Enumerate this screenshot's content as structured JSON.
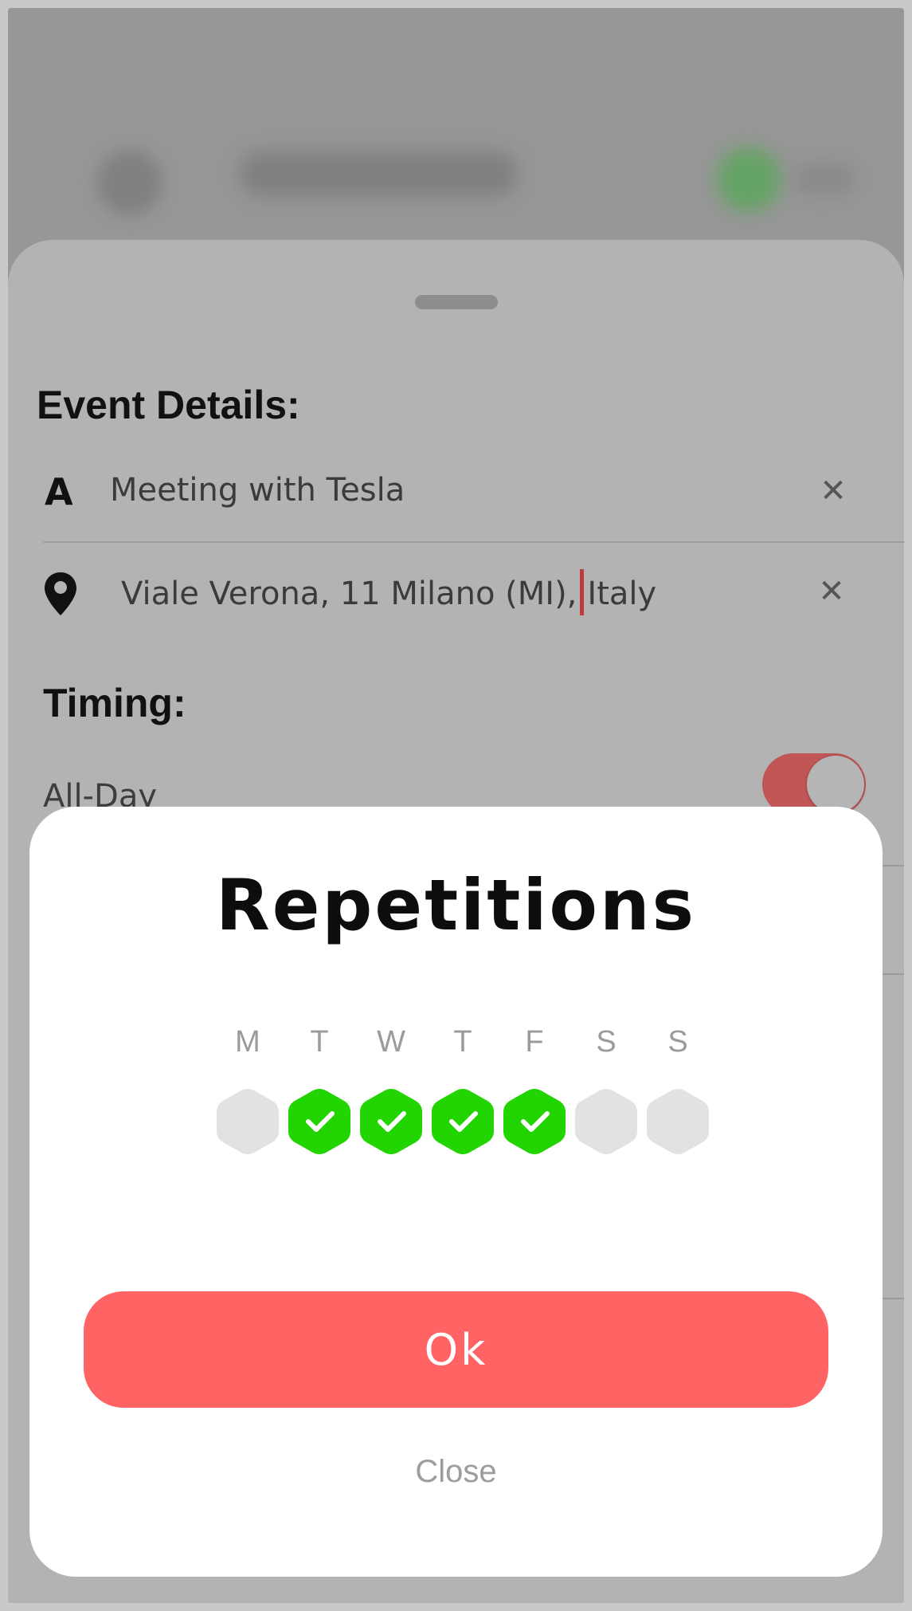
{
  "event_details": {
    "heading": "Event Details:",
    "title_value": "Meeting with Tesla",
    "title_icon": "A",
    "location_before_cursor": "Viale Verona, 11 Milano (MI),",
    "location_after_cursor": "Italy"
  },
  "timing": {
    "heading": "Timing:",
    "all_day_label": "All-Day",
    "all_day_on": true
  },
  "repetitions_modal": {
    "title": "Repetitions",
    "days": [
      {
        "letter": "M",
        "selected": false
      },
      {
        "letter": "T",
        "selected": true
      },
      {
        "letter": "W",
        "selected": true
      },
      {
        "letter": "T",
        "selected": true
      },
      {
        "letter": "F",
        "selected": true
      },
      {
        "letter": "S",
        "selected": false
      },
      {
        "letter": "S",
        "selected": false
      }
    ],
    "ok_label": "Ok",
    "close_label": "Close"
  },
  "colors": {
    "selected_day": "#22d400",
    "unselected_day": "#e2e2e2",
    "primary_button": "#ff6363",
    "toggle_on": "#c15656"
  },
  "icons": {
    "title_field": "text-a-icon",
    "location_field": "map-pin-icon",
    "clear": "close-icon",
    "selected_day": "checkmark-icon"
  }
}
